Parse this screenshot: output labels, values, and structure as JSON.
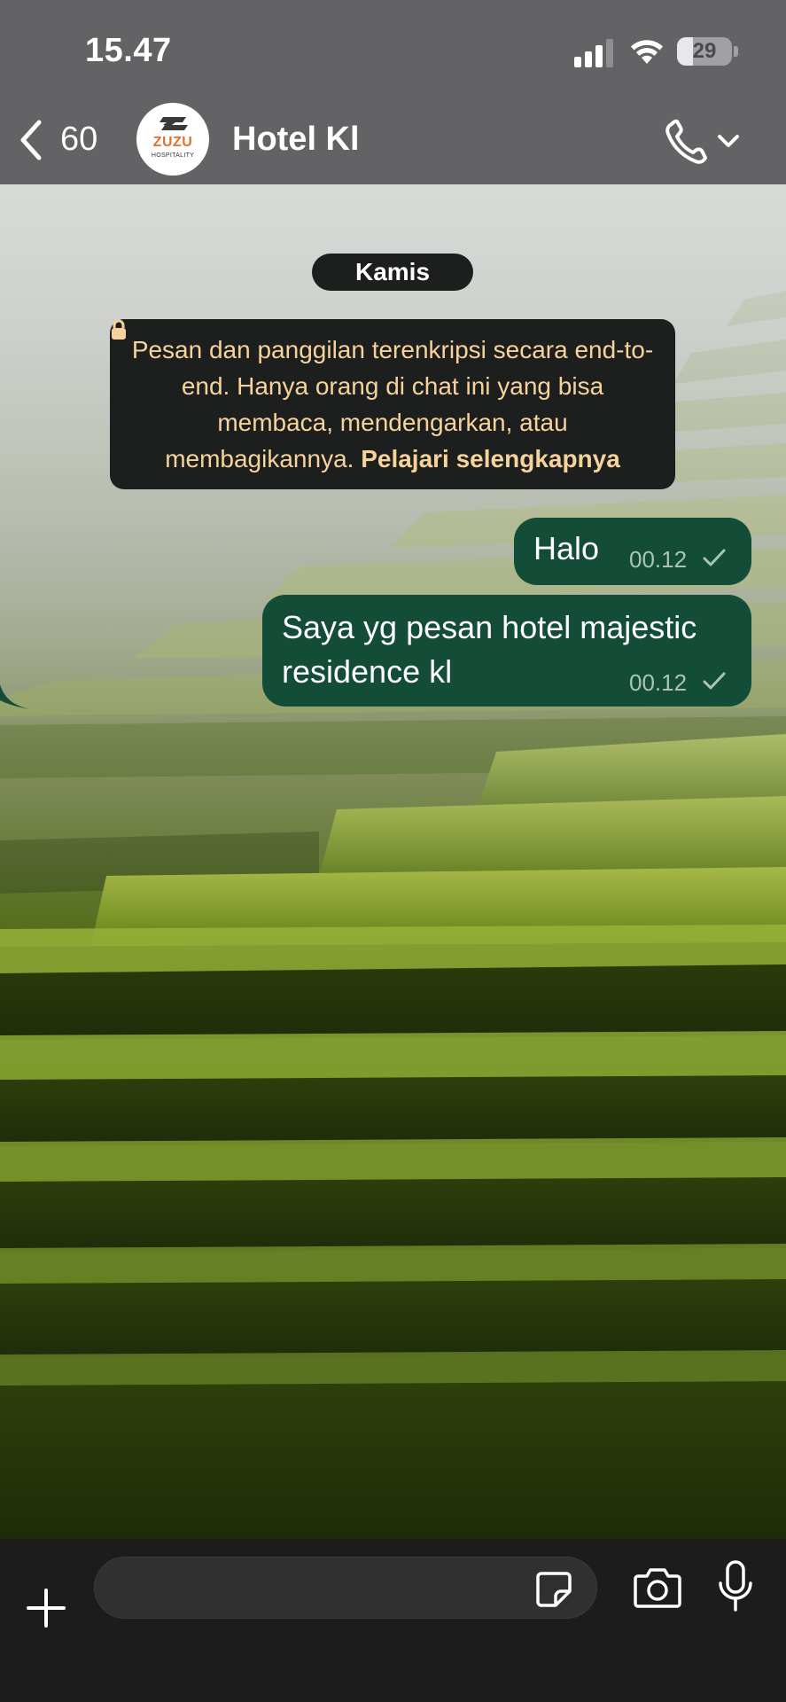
{
  "status_bar": {
    "time": "15.47",
    "battery_level": "29",
    "battery_fraction": 0.29
  },
  "header": {
    "back_count": "60",
    "contact_name": "Hotel Kl",
    "avatar_text": "ZUZU",
    "avatar_subtext": "HOSPITALITY",
    "avatar_brand_color": "#e8702a"
  },
  "chat": {
    "date_label": "Kamis",
    "encryption_notice": {
      "text": "Pesan dan panggilan terenkripsi secara end-to-end. Hanya orang di chat ini yang bisa membaca, mendengarkan, atau membagikannya.",
      "link_text": "Pelajari selengkapnya",
      "color": "#f6d39a"
    },
    "messages": [
      {
        "text": "Halo",
        "time": "00.12",
        "status": "sent",
        "direction": "outgoing"
      },
      {
        "text": "Saya yg pesan hotel majestic residence kl",
        "time": "00.12",
        "status": "sent",
        "direction": "outgoing"
      }
    ],
    "outgoing_bubble_color": "#144d37"
  },
  "input_bar": {
    "placeholder": "",
    "icons": [
      "plus-icon",
      "sticker-icon",
      "camera-icon",
      "microphone-icon"
    ]
  }
}
